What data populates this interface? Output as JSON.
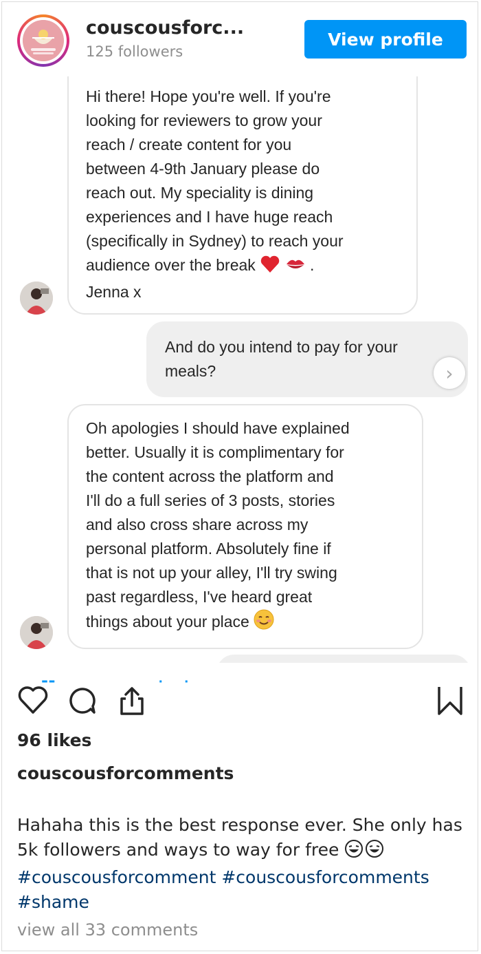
{
  "header": {
    "username": "couscousforc...",
    "followers": "125 followers",
    "view_profile": "View profile"
  },
  "messages": [
    {
      "from": "Jenna",
      "text_lines": [
        "Hi there! Hope you're well. If you're",
        "looking for reviewers to grow your",
        "reach / create content for you",
        "between 4-9th January please do",
        "reach out. My speciality is dining",
        "experiences and I have huge reach",
        "(specifically in Sydney) to reach your"
      ],
      "last_line": "audience over the break",
      "last_line_end": ".",
      "signoff": "Jenna x"
    },
    {
      "from": "business",
      "text_lines": [
        "And do you intend to pay for your",
        "meals?"
      ]
    },
    {
      "from": "Jenna",
      "text_lines": [
        "Oh apologies I should have explained",
        "better. Usually it is complimentary for",
        "the content across the platform and",
        "I'll do a full series of 3 posts, stories",
        "and also cross share across my",
        "personal platform. Absolutely fine if",
        "that is not up your alley, I'll try swing",
        "past regardless, I've heard great"
      ],
      "last_line": "things about your place"
    }
  ],
  "post": {
    "likes": "96 likes",
    "caption_user": "couscousforcomments",
    "caption_text": "Hahaha this is the best response ever. She only has 5k followers and ways to way for free",
    "hashtags": [
      "#couscousforcomment",
      "#couscousforcomments",
      "#shame"
    ],
    "view_comments": "view all 33 comments"
  },
  "icons": {
    "like": "heart-icon",
    "comment": "comment-icon",
    "share": "share-icon",
    "save": "bookmark-icon",
    "next": "chevron-right-icon"
  },
  "colors": {
    "accent": "#0095f6",
    "hashtag": "#00376b",
    "muted": "#8e8e8e"
  }
}
